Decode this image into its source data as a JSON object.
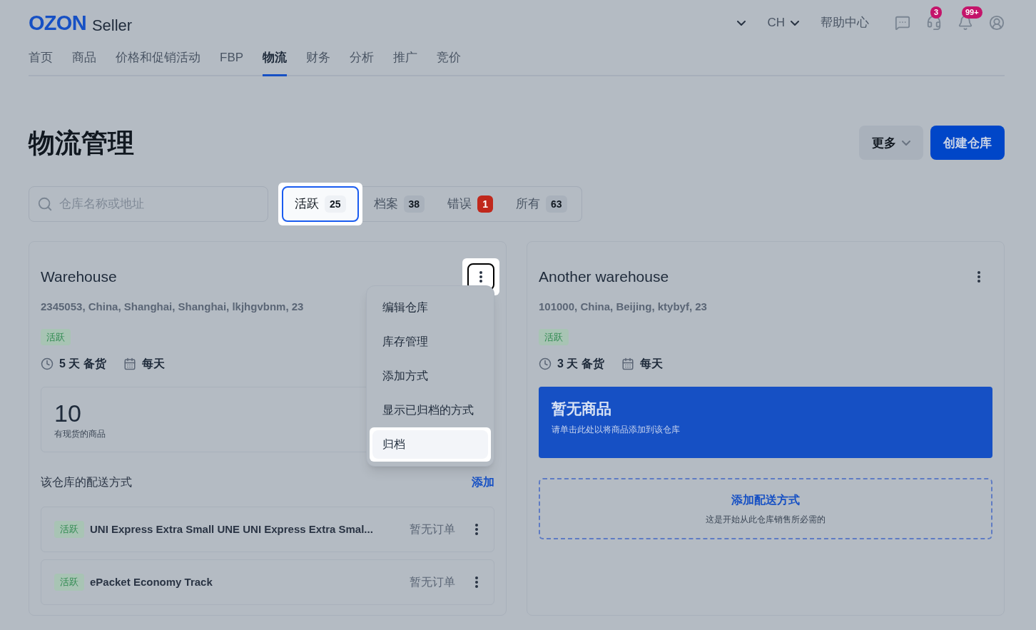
{
  "header": {
    "logo": {
      "brand": "OZON",
      "product": "Seller"
    },
    "top_actions": [
      {
        "kind": "dropdown"
      },
      {
        "kind": "dropdown",
        "label": "CH"
      },
      {
        "kind": "link",
        "label": "帮助中心"
      }
    ],
    "icons": [
      {
        "kind": "chat"
      },
      {
        "kind": "support",
        "badge": "3"
      },
      {
        "kind": "bell",
        "badge": "99+"
      },
      {
        "kind": "profile"
      }
    ]
  },
  "nav": [
    {
      "label": "首页",
      "selected": false
    },
    {
      "label": "商品",
      "selected": false
    },
    {
      "label": "价格和促销活动",
      "selected": false
    },
    {
      "label": "FBP",
      "selected": false
    },
    {
      "label": "物流",
      "selected": true
    },
    {
      "label": "财务",
      "selected": false
    },
    {
      "label": "分析",
      "selected": false
    },
    {
      "label": "推广",
      "selected": false
    },
    {
      "label": "竞价",
      "selected": false
    }
  ],
  "page": {
    "title": "物流管理",
    "more_button": "更多",
    "create_button": "创建仓库"
  },
  "search": {
    "placeholder": "仓库名称或地址"
  },
  "filter_tabs": [
    {
      "label": "活跃",
      "count": "25",
      "selected": true,
      "kind": "default"
    },
    {
      "label": "档案",
      "count": "38",
      "selected": false,
      "kind": "default"
    },
    {
      "label": "错误",
      "count": "1",
      "selected": false,
      "kind": "alert"
    },
    {
      "label": "所有",
      "count": "63",
      "selected": false,
      "kind": "default"
    }
  ],
  "warehouses": [
    {
      "name": "Warehouse",
      "address": "2345053, China, Shanghai, Shanghai, lkjhgvbnm, 23",
      "status": "活跃",
      "prep": "5 天 备货",
      "schedule": "每天",
      "menu_open": true,
      "stock": {
        "kind": "count",
        "count": "10",
        "label": "有现货的商品"
      },
      "menu": [
        {
          "label": "编辑仓库",
          "selected": false
        },
        {
          "label": "库存管理",
          "selected": false
        },
        {
          "label": "添加方式",
          "selected": false
        },
        {
          "label": "显示已归档的方式",
          "selected": false
        },
        {
          "label": "归档",
          "selected": true
        }
      ],
      "delivery": {
        "title": "该仓库的配送方式",
        "add_link": "添加",
        "methods": [
          {
            "status": "活跃",
            "name": "UNI Express Extra Small UNE UNI Express Extra Smal...",
            "orders": "暂无订单"
          },
          {
            "status": "活跃",
            "name": "ePacket Economy Track",
            "orders": "暂无订单"
          }
        ]
      }
    },
    {
      "name": "Another warehouse",
      "address": "101000, China, Beijing, ktybyf, 23",
      "status": "活跃",
      "prep": "3 天 备货",
      "schedule": "每天",
      "menu_open": false,
      "stock": {
        "kind": "empty",
        "title": "暂无商品",
        "label": "请单击此处以将商品添加到该仓库"
      },
      "add_delivery": {
        "title": "添加配送方式",
        "subtitle": "这是开始从此仓库销售所必需的"
      }
    }
  ]
}
